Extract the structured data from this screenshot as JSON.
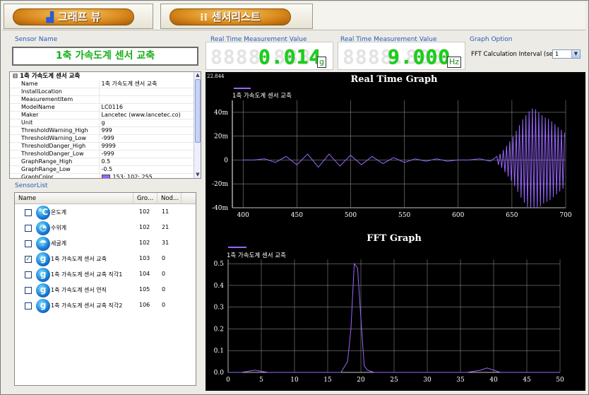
{
  "tabs": [
    {
      "label": "그래프 뷰",
      "icon": "bar-chart-icon"
    },
    {
      "label": "센서리스트",
      "icon": "grid-list-icon"
    }
  ],
  "sensor_name": {
    "group_label": "Sensor Name",
    "value": "1축 가속도계 센서 교축"
  },
  "properties": {
    "header": "1축 가속도계 센서 교축",
    "rows": [
      {
        "key": "Name",
        "value": "1축 가속도계 센서 교축"
      },
      {
        "key": "InstallLocation",
        "value": ""
      },
      {
        "key": "MeasurementItem",
        "value": ""
      },
      {
        "key": "ModelName",
        "value": "LC0116"
      },
      {
        "key": "Maker",
        "value": "Lancetec (www.lancetec.co)"
      },
      {
        "key": "Unit",
        "value": "g"
      },
      {
        "key": "ThresholdWarning_High",
        "value": "999"
      },
      {
        "key": "ThresholdWarning_Low",
        "value": "-999"
      },
      {
        "key": "ThresholdDanger_High",
        "value": "9999"
      },
      {
        "key": "ThresholdDanger_Low",
        "value": "-999"
      },
      {
        "key": "GraphRange_High",
        "value": "0.5"
      },
      {
        "key": "GraphRange_Low",
        "value": "-0.5"
      },
      {
        "key": "GraphColor",
        "value": "153; 102; 255",
        "color": "#9966ff"
      }
    ]
  },
  "sensor_list": {
    "group_label": "SensorList",
    "columns": [
      "Name",
      "Gro...",
      "Nod..."
    ],
    "rows": [
      {
        "checked": false,
        "icon": "thermometer-icon",
        "glyph": "℃",
        "name": "온도계",
        "group": "102",
        "node": "11"
      },
      {
        "checked": false,
        "icon": "water-level-icon",
        "glyph": "◔",
        "name": "수위계",
        "group": "102",
        "node": "21"
      },
      {
        "checked": false,
        "icon": "rain-gauge-icon",
        "glyph": "☂",
        "name": "세굴계",
        "group": "102",
        "node": "31"
      },
      {
        "checked": true,
        "icon": "accelerometer-icon",
        "glyph": "g",
        "name": "1축 가속도계 센서 교축",
        "group": "103",
        "node": "0"
      },
      {
        "checked": false,
        "icon": "accelerometer-icon",
        "glyph": "g",
        "name": "1축 가속도계 센서 교축 직각1",
        "group": "104",
        "node": "0"
      },
      {
        "checked": false,
        "icon": "accelerometer-icon",
        "glyph": "g",
        "name": "1축 가속도계 센서 연직",
        "group": "105",
        "node": "0"
      },
      {
        "checked": false,
        "icon": "accelerometer-icon",
        "glyph": "g",
        "name": "1축 가속도계 센서 교축 직각2",
        "group": "106",
        "node": "0"
      }
    ]
  },
  "measure1": {
    "label": "Real Time Measurement Value",
    "ghost": "8888.888",
    "value": "0.014",
    "unit": "g"
  },
  "measure2": {
    "label": "Real Time Measurement Value",
    "ghost": "8888.888",
    "value": "9.000",
    "unit": "Hz"
  },
  "graph_option": {
    "label": "Graph Option",
    "field_label": "FFT Calculation Interval (sec)",
    "selected": "1"
  },
  "colors": {
    "accent": "#2a5ab8",
    "lcd_green": "#18d018",
    "series": "#9966ff"
  },
  "chart_data": [
    {
      "type": "line",
      "title": "Real Time Graph",
      "corner_label": "22.844",
      "legend": "1축 가속도계 센서 교축",
      "xlim": [
        390,
        700
      ],
      "ylim": [
        -40,
        50
      ],
      "xticks": [
        400,
        450,
        500,
        550,
        600,
        650,
        700
      ],
      "yticks": [
        40,
        20,
        0,
        -20,
        -40
      ],
      "ytick_labels": [
        "40m",
        "20m",
        "0",
        "-20m",
        "-40m"
      ],
      "grid": true,
      "series": [
        {
          "name": "1축 가속도계 센서 교축",
          "color": "#9966ff",
          "x": [
            400,
            410,
            420,
            430,
            440,
            450,
            460,
            470,
            480,
            490,
            500,
            510,
            520,
            530,
            540,
            550,
            560,
            570,
            580,
            590,
            600,
            610,
            620,
            630,
            640,
            650,
            660,
            670,
            680,
            690,
            700
          ],
          "y": [
            0,
            0,
            1,
            -2,
            3,
            -4,
            5,
            -6,
            5,
            -5,
            4,
            -4,
            3,
            -3,
            2,
            -2,
            1,
            -1,
            1,
            -1,
            0,
            0,
            1,
            -1,
            0,
            0,
            0,
            0,
            0,
            0,
            0
          ],
          "osc_from": 636,
          "osc_to": 700,
          "amplitudes": [
            [
              636,
              3
            ],
            [
              640,
              6
            ],
            [
              645,
              12
            ],
            [
              650,
              18
            ],
            [
              655,
              26
            ],
            [
              660,
              34
            ],
            [
              665,
              40
            ],
            [
              670,
              44
            ],
            [
              675,
              40
            ],
            [
              680,
              36
            ],
            [
              685,
              34
            ],
            [
              690,
              30
            ],
            [
              695,
              26
            ],
            [
              700,
              22
            ]
          ]
        }
      ]
    },
    {
      "type": "line",
      "title": "FFT Graph",
      "legend": "1축 가속도계 센서 교축",
      "xlim": [
        0,
        50
      ],
      "ylim": [
        0,
        0.52
      ],
      "xticks": [
        0,
        5,
        10,
        15,
        20,
        25,
        30,
        35,
        40,
        45,
        50
      ],
      "yticks": [
        0.5,
        0.4,
        0.3,
        0.2,
        0.1,
        0.0
      ],
      "ytick_labels": [
        "0.5",
        "0.4",
        "0.3",
        "0.2",
        "0.1",
        "0.0"
      ],
      "grid": true,
      "series": [
        {
          "name": "1축 가속도계 센서 교축",
          "color": "#9966ff",
          "x": [
            0,
            2,
            4,
            6,
            8,
            10,
            12,
            14,
            16,
            17,
            18,
            18.5,
            19,
            19.5,
            20,
            20.5,
            21,
            22,
            24,
            26,
            28,
            30,
            32,
            34,
            36,
            38,
            39,
            40,
            41,
            42,
            44,
            46,
            48,
            50
          ],
          "y": [
            0.0,
            0.0,
            0.01,
            0.0,
            0.0,
            0.0,
            0.0,
            0.0,
            0.0,
            0.0,
            0.05,
            0.2,
            0.5,
            0.48,
            0.25,
            0.03,
            0.01,
            0.0,
            0.0,
            0.0,
            0.0,
            0.0,
            0.0,
            0.0,
            0.0,
            0.01,
            0.02,
            0.01,
            0.0,
            0.0,
            0.0,
            0.0,
            0.0,
            0.0
          ]
        }
      ]
    }
  ]
}
